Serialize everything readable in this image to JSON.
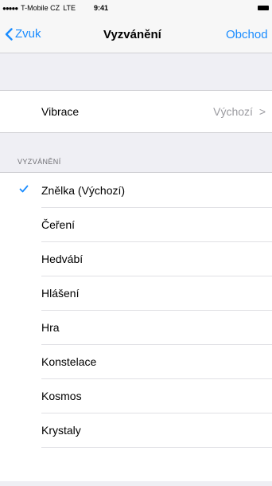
{
  "status_bar": {
    "signal": "●●●●●",
    "carrier": "T-Mobile CZ",
    "network": "LTE",
    "time": "9:41"
  },
  "nav": {
    "back_label": "Zvuk",
    "title": "Vyzvánění",
    "store_label": "Obchod",
    "accent_color": "#1a8cff"
  },
  "vibration": {
    "label": "Vibrace",
    "value": "Výchozí",
    "chevron": ">"
  },
  "ringtones": {
    "header": "VYZVÁNĚNÍ",
    "items": [
      {
        "label": "Znělka (Výchozí)",
        "selected": true
      },
      {
        "label": "Čeření"
      },
      {
        "label": "Hedvábí"
      },
      {
        "label": "Hlášení"
      },
      {
        "label": "Hra"
      },
      {
        "label": "Konstelace"
      },
      {
        "label": "Kosmos"
      },
      {
        "label": "Krystaly"
      }
    ]
  }
}
